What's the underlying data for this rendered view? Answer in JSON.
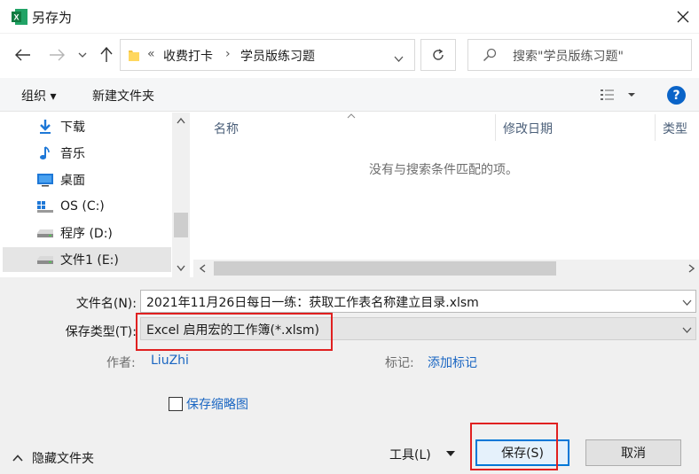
{
  "window": {
    "title": "另存为"
  },
  "nav": {
    "breadcrumb_prefix": "«",
    "breadcrumb": [
      "收费打卡",
      "学员版练习题"
    ],
    "search_placeholder": "搜索\"学员版练习题\""
  },
  "toolbar": {
    "organize_label": "组织 ▾",
    "new_folder_label": "新建文件夹",
    "help_label": "?"
  },
  "sidebar": {
    "items": [
      {
        "label": "下载",
        "icon": "download-icon"
      },
      {
        "label": "音乐",
        "icon": "music-icon"
      },
      {
        "label": "桌面",
        "icon": "desktop-icon"
      },
      {
        "label": "OS (C:)",
        "icon": "windows-drive-icon"
      },
      {
        "label": "程序 (D:)",
        "icon": "drive-icon"
      },
      {
        "label": "文件1 (E:)",
        "icon": "drive-icon",
        "selected": true
      }
    ]
  },
  "file_list": {
    "columns": [
      "名称",
      "修改日期",
      "类型"
    ],
    "empty_message": "没有与搜索条件匹配的项。"
  },
  "form": {
    "filename_label": "文件名(N):",
    "filename_value": "2021年11月26日每日一练：获取工作表名称建立目录.xlsm",
    "filetype_label": "保存类型(T):",
    "filetype_value": "Excel 启用宏的工作簿(*.xlsm)",
    "author_label": "作者:",
    "author_value": "LiuZhi",
    "tags_label": "标记:",
    "tags_value": "添加标记",
    "thumbnail_label": "保存缩略图",
    "thumbnail_checked": false
  },
  "footer": {
    "hide_folders_label": "隐藏文件夹",
    "tools_label": "工具(L)",
    "save_label": "保存(S)",
    "cancel_label": "取消"
  },
  "colors": {
    "accent": "#1a66c2",
    "highlight_red": "#e02020",
    "excel_green": "#1d6f42"
  }
}
